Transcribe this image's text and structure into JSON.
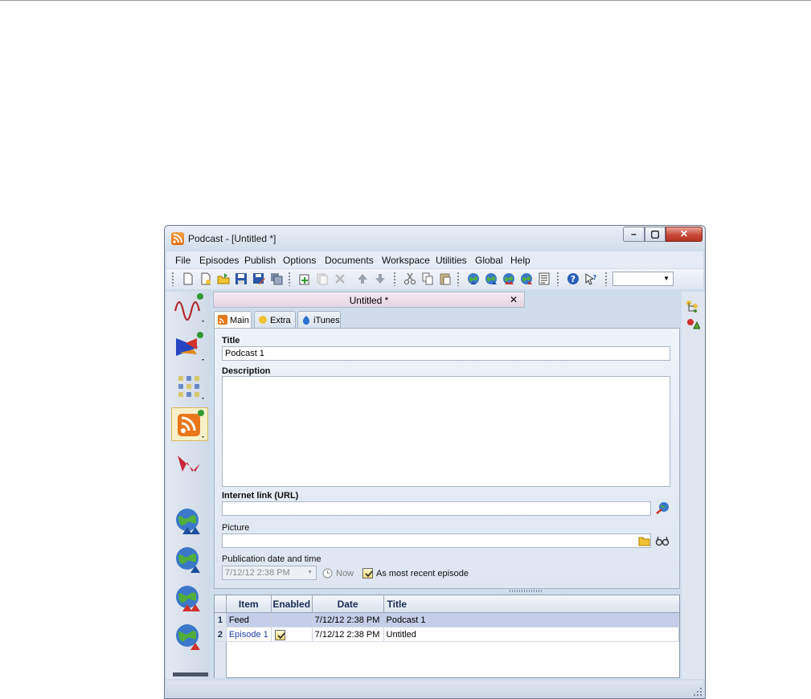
{
  "window": {
    "title": "Podcast - [Untitled *]"
  },
  "menu": [
    "File",
    "Episodes",
    "Publish",
    "Options",
    "Documents",
    "Workspace",
    "Utilities",
    "Global",
    "Help"
  ],
  "doc_tab": {
    "title": "Untitled *"
  },
  "tabs": [
    "Main",
    "Extra",
    "iTunes"
  ],
  "form": {
    "title_label": "Title",
    "title_value": "Podcast 1",
    "description_label": "Description",
    "url_label": "Internet link (URL)",
    "picture_label": "Picture",
    "pubdate_label": "Publication date and time",
    "pubdate_value": "7/12/12 2:38 PM",
    "now_label": "Now",
    "recent_label": "As most recent episode",
    "recent_checked": true
  },
  "grid": {
    "columns": [
      "Item",
      "Enabled",
      "Date",
      "Title"
    ],
    "rows": [
      {
        "n": "1",
        "item": "Feed",
        "enabled": "",
        "date": "7/12/12 2:38 PM",
        "title": "Podcast 1",
        "selected": true
      },
      {
        "n": "2",
        "item": "Episode 1",
        "enabled": "checked",
        "date": "7/12/12 2:38 PM",
        "title": "Untitled",
        "selected": false
      }
    ]
  },
  "colors": {
    "accent_orange": "#e8761a",
    "link_blue": "#1f3fb5",
    "selection": "#c4cde9"
  }
}
